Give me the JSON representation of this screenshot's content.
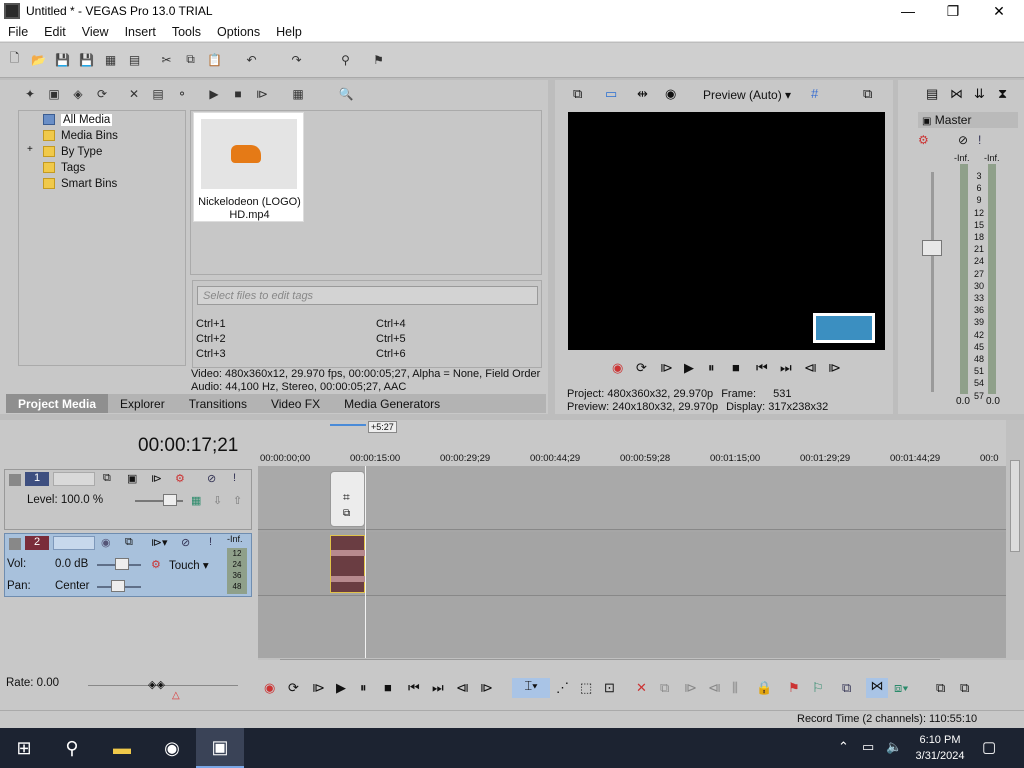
{
  "window": {
    "title": "Untitled * - VEGAS Pro 13.0 TRIAL",
    "minimize": "—",
    "maximize": "❐",
    "close": "✕"
  },
  "menu": [
    "File",
    "Edit",
    "View",
    "Insert",
    "Tools",
    "Options",
    "Help"
  ],
  "project_media": {
    "tree": [
      "All Media",
      "Media Bins",
      "By Type",
      "Tags",
      "Smart Bins"
    ],
    "tree_expand": "+",
    "media_item": {
      "name_line1": "Nickelodeon (LOGO)",
      "name_line2": "HD.mp4"
    },
    "tags_placeholder": "Select files to edit tags",
    "shortcuts": [
      "Ctrl+1",
      "Ctrl+2",
      "Ctrl+3",
      "Ctrl+4",
      "Ctrl+5",
      "Ctrl+6"
    ],
    "info_video": "Video: 480x360x12, 29.970 fps, 00:00:05;27, Alpha = None, Field Order",
    "info_audio": "Audio: 44,100 Hz, Stereo, 00:00:05;27, AAC",
    "tabs": [
      "Project Media",
      "Explorer",
      "Transitions",
      "Video FX",
      "Media Generators"
    ]
  },
  "preview": {
    "mode": "Preview (Auto)",
    "project_label": "Project:",
    "project_value": "480x360x32, 29.970p",
    "frame_label": "Frame:",
    "frame_value": "531",
    "preview_label": "Preview:",
    "preview_value": "240x180x32, 29.970p",
    "display_label": "Display:",
    "display_value": "317x238x32"
  },
  "mixer": {
    "title": "Master",
    "inf_left": "-Inf.",
    "inf_right": "-Inf.",
    "scale": [
      "3",
      "6",
      "9",
      "12",
      "15",
      "18",
      "21",
      "24",
      "27",
      "30",
      "33",
      "36",
      "39",
      "42",
      "45",
      "48",
      "51",
      "54",
      "57"
    ],
    "val_left": "0.0",
    "val_right": "0.0"
  },
  "timeline": {
    "timecode": "00:00:17;21",
    "region_len": "+5:27",
    "ruler": [
      "00:00:00;00",
      "00:00:15:00",
      "00:00:29;29",
      "00:00:44;29",
      "00:00:59;28",
      "00:01:15;00",
      "00:01:29;29",
      "00:01:44;29",
      "00:0"
    ],
    "track1": {
      "number": "1",
      "level": "Level: 100.0 %"
    },
    "track2": {
      "number": "2",
      "vol_label": "Vol:",
      "vol_value": "0.0 dB",
      "pan_label": "Pan:",
      "pan_value": "Center",
      "automation": "Touch",
      "inf": "-Inf.",
      "meter": [
        "12",
        "24",
        "36",
        "48"
      ]
    },
    "rate": "Rate: 0.00"
  },
  "status": {
    "record_time": "Record Time (2 channels): 110:55:10"
  },
  "taskbar": {
    "time": "6:10 PM",
    "date": "3/31/2024"
  }
}
